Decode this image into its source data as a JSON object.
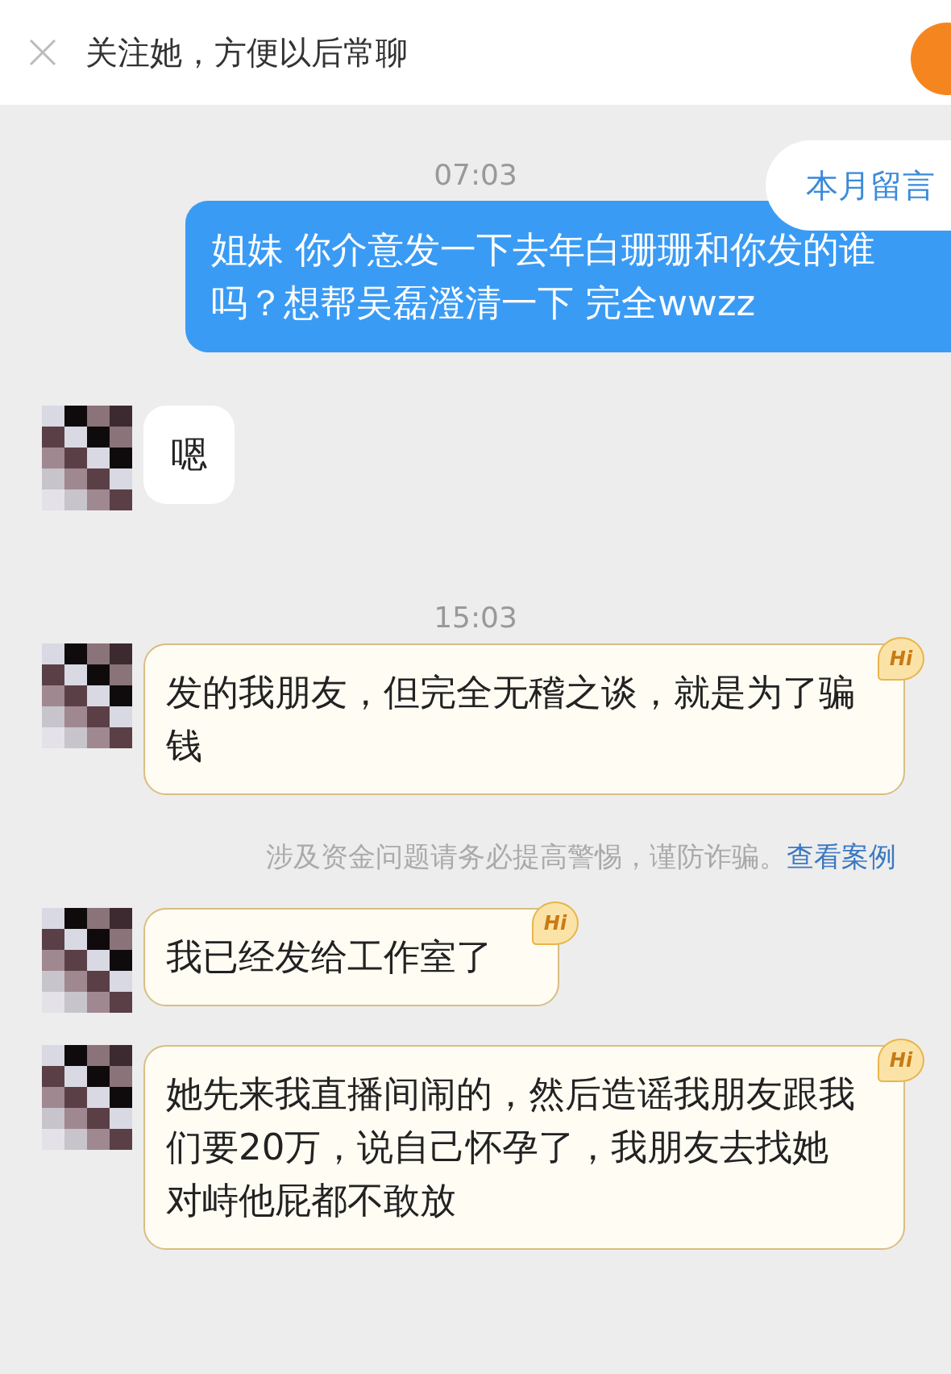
{
  "header": {
    "title": "关注她，方便以后常聊"
  },
  "notice_pill": {
    "label": "本月留言"
  },
  "messages": [
    {
      "kind": "time",
      "text": "07:03"
    },
    {
      "kind": "outgoing",
      "text": "姐妹 你介意发一下去年白珊珊和你发的谁吗？想帮吴磊澄清一下 完全wwzz"
    },
    {
      "kind": "incoming",
      "text": "嗯",
      "badge": false
    },
    {
      "kind": "time",
      "text": "15:03"
    },
    {
      "kind": "incoming",
      "text": "发的我朋友，但完全无稽之谈，就是为了骗钱",
      "badge": "Hi"
    },
    {
      "kind": "warning",
      "text": "涉及资金问题请务必提高警惕，谨防诈骗。",
      "link": "查看案例"
    },
    {
      "kind": "incoming",
      "text": "我已经发给工作室了",
      "badge": "Hi"
    },
    {
      "kind": "incoming",
      "text": "她先来我直播间闹的，然后造谣我朋友跟我们要20万，说自己怀孕了，我朋友去找她对峙他屁都不敢放",
      "badge": "Hi"
    }
  ]
}
